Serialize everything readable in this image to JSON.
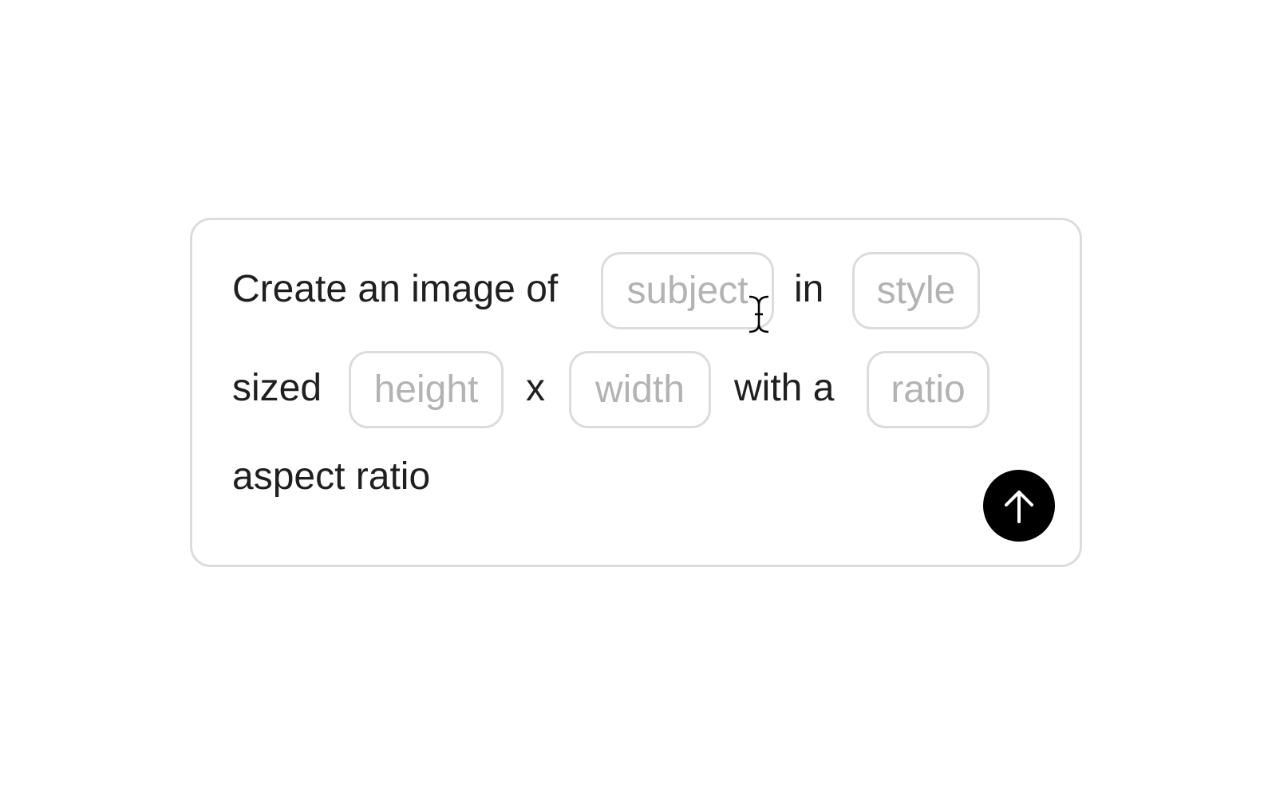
{
  "prompt": {
    "w1": "Create an image of",
    "subject_placeholder": "subject",
    "w2": "in",
    "style_placeholder": "style",
    "w3": "sized",
    "height_placeholder": "height",
    "w4": "x",
    "width_placeholder": "width",
    "w5": "with a",
    "ratio_placeholder": "ratio",
    "w6": "aspect ratio"
  },
  "submit": {
    "icon": "arrow-up-icon"
  }
}
